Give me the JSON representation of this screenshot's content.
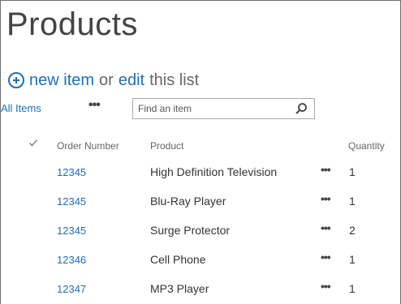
{
  "page": {
    "title": "Products"
  },
  "actions": {
    "new_item": "new item",
    "or": "or",
    "edit": "edit",
    "this_list": "this list"
  },
  "views": {
    "current": "All Items",
    "more": "•••"
  },
  "search": {
    "placeholder": "Find an item"
  },
  "table": {
    "columns": [
      "Order Number",
      "Product",
      "Quantity"
    ],
    "rows": [
      {
        "order": "12345",
        "product": "High Definition Television",
        "quantity": "1"
      },
      {
        "order": "12345",
        "product": "Blu-Ray Player",
        "quantity": "1"
      },
      {
        "order": "12345",
        "product": "Surge Protector",
        "quantity": "2"
      },
      {
        "order": "12346",
        "product": "Cell Phone",
        "quantity": "1"
      },
      {
        "order": "12347",
        "product": "MP3 Player",
        "quantity": "1"
      }
    ],
    "row_menu": "•••"
  },
  "colors": {
    "link": "#1f6fb5",
    "text": "#333333",
    "muted": "#666666"
  }
}
